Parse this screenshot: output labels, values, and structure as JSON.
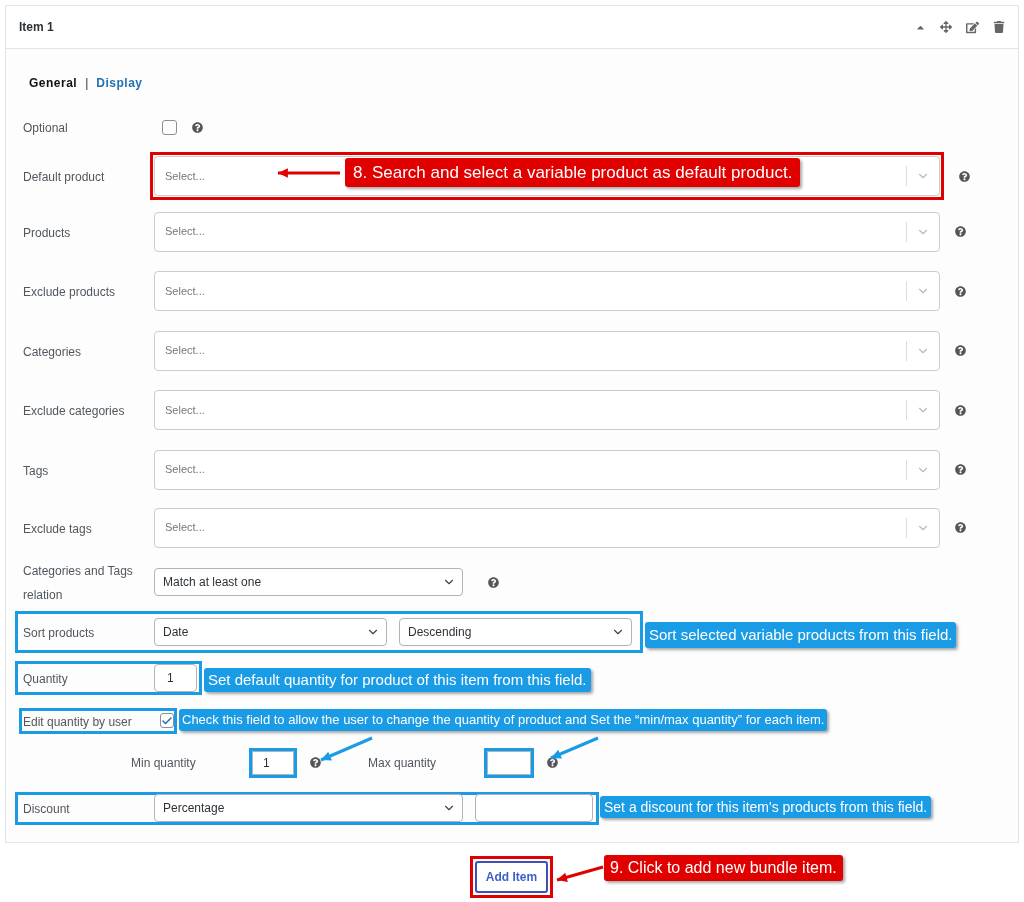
{
  "item": {
    "title": "Item 1"
  },
  "tabs": [
    {
      "label": "General",
      "selected": true
    },
    {
      "label": "Display",
      "selected": false
    }
  ],
  "tab_separator": "|",
  "fields": [
    {
      "kind": "checkbox",
      "label": "Optional",
      "checked": false,
      "help": true
    },
    {
      "kind": "search-select",
      "label": "Default product",
      "placeholder": "Select...",
      "help": true
    },
    {
      "kind": "search-select",
      "label": "Products",
      "placeholder": "Select...",
      "help": true
    },
    {
      "kind": "search-select",
      "label": "Exclude products",
      "placeholder": "Select...",
      "help": true
    },
    {
      "kind": "search-select",
      "label": "Categories",
      "placeholder": "Select...",
      "help": true
    },
    {
      "kind": "search-select",
      "label": "Exclude categories",
      "placeholder": "Select...",
      "help": true
    },
    {
      "kind": "search-select",
      "label": "Tags",
      "placeholder": "Select...",
      "help": true
    },
    {
      "kind": "search-select",
      "label": "Exclude tags",
      "placeholder": "Select...",
      "help": true
    },
    {
      "kind": "dropdown",
      "label": "Categories and Tags relation",
      "value": "Match at least one",
      "help": true
    },
    {
      "kind": "dropdown-pair",
      "label": "Sort products",
      "values": [
        "Date",
        "Descending"
      ]
    },
    {
      "kind": "number",
      "label": "Quantity",
      "value": "1"
    },
    {
      "kind": "checkbox",
      "label": "Edit quantity by user",
      "checked": true
    },
    {
      "kind": "min-max",
      "min_label": "Min quantity",
      "min_value": "1",
      "max_label": "Max quantity"
    },
    {
      "kind": "discount",
      "label": "Discount",
      "value": "Percentage"
    }
  ],
  "add_button": "Add Item",
  "annotations": [
    {
      "color": "#e00000",
      "text": "8. Search and select a variable product as default product."
    },
    {
      "color": "#1a9be6",
      "text": "Sort selected variable products from this field."
    },
    {
      "color": "#1a9be6",
      "text": "Set default quantity for product of this item from this field."
    },
    {
      "color": "#1a9be6",
      "text": "Check this field to allow the user to change the quantity of product and Set the “min/max quantity” for each item."
    },
    {
      "color": "#1a9be6",
      "text": "Set a discount for this item's products from this field."
    },
    {
      "color": "#e00000",
      "text": "9. Click to add new bundle item."
    }
  ]
}
